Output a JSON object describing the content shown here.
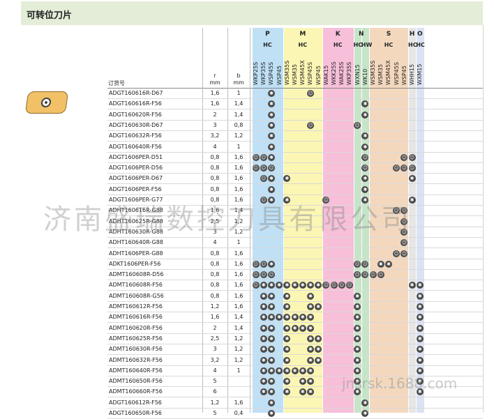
{
  "title": "可转位刀片",
  "headers": {
    "order_no": "订货号",
    "r": "r",
    "r_unit": "mm",
    "b": "b",
    "b_unit": "mm"
  },
  "groups": [
    {
      "letter": "P",
      "sub": "HC",
      "color": "#bfe0f5",
      "grades": [
        "WKP25S",
        "WKP35S",
        "WSP45S",
        "WSP45"
      ]
    },
    {
      "letter": "M",
      "sub": "HC",
      "color": "#fbf6b4",
      "grades": [
        "WSM35S",
        "WSM35",
        "WSM45X",
        "WSP45S",
        "WSP45"
      ]
    },
    {
      "letter": "K",
      "sub": "HC",
      "color": "#f7bfd9",
      "grades": [
        "WAK15",
        "WKK25S",
        "WAK25S",
        "WKP35S"
      ]
    },
    {
      "letter": "N",
      "sub": "HC",
      "color": "#c6e5c8",
      "grades": [
        "WXN15"
      ]
    },
    {
      "letter": "",
      "sub": "HW",
      "color": "#c6e5c8",
      "grades": [
        "WK10"
      ]
    },
    {
      "letter": "S",
      "sub": "HC",
      "color": "#f4d8be",
      "grades": [
        "WSM35S",
        "WSM35",
        "WSM45X",
        "WSP45S",
        "WSP45"
      ]
    },
    {
      "letter": "H",
      "sub": "HC",
      "color": "#e6e6e6",
      "grades": [
        "WHH15"
      ]
    },
    {
      "letter": "O",
      "sub": "HC",
      "color": "#dbe2f3",
      "grades": [
        "WXM15"
      ]
    }
  ],
  "rows": [
    {
      "code": "ADGT160616R-D67",
      "r": "1,6",
      "b": "1",
      "marks": "..2....1....................1....."
    },
    {
      "code": "ADGT160616R-F56",
      "r": "1,6",
      "b": "1,4",
      "marks": "..3...........2..............2...."
    },
    {
      "code": "ADGT160620R-F56",
      "r": "2",
      "b": "1,4",
      "marks": "..3...........2..............2...."
    },
    {
      "code": "ADGT160630R-D67",
      "r": "3",
      "b": "0,8",
      "marks": "..2....1.....1..............1....."
    },
    {
      "code": "ADGT160632R-F56",
      "r": "3,2",
      "b": "1,2",
      "marks": "..3...........2..............2...."
    },
    {
      "code": "ADGT160640R-F56",
      "r": "4",
      "b": "1",
      "marks": "..3...........2..............2...."
    },
    {
      "code": "ADGT1606PER-D51",
      "r": "0,8",
      "b": "1,6",
      "marks": "112...........1....11........1...."
    },
    {
      "code": "ADGT1606PER-D56",
      "r": "0,8",
      "b": "1,6",
      "marks": "111...........1...111........1...."
    },
    {
      "code": "ADGT1606PER-D67",
      "r": "0,8",
      "b": "1,6",
      "marks": ".12.2.........2.....2.....2..1...."
    },
    {
      "code": "ADGT1606PER-F56",
      "r": "0,8",
      "b": "1,6",
      "marks": "..3...........2..............2...."
    },
    {
      "code": "ADGT1606PER-G77",
      "r": "0,8",
      "b": "1,6",
      "marks": ".12.2....1....2.....2.....2..1...."
    },
    {
      "code": "ADHT160616R-G88",
      "r": "1,6",
      "b": "1,4",
      "marks": "..................11......."
    },
    {
      "code": "ADHT160625R-G88",
      "r": "2,5",
      "b": "1,2",
      "marks": "...................1......."
    },
    {
      "code": "ADHT160630R-G88",
      "r": "3",
      "b": "1,2",
      "marks": "...................1......."
    },
    {
      "code": "ADHT160640R-G88",
      "r": "4",
      "b": "1",
      "marks": "...................1......."
    },
    {
      "code": "ADHT1606PER-G88",
      "r": "0,8",
      "b": "1,6",
      "marks": "..................11......."
    },
    {
      "code": "ADKT1606PER-F56",
      "r": "0,8",
      "b": "1,6",
      "marks": "112..........11.22..........2...."
    },
    {
      "code": "ADMT160608R-D56",
      "r": "0,8",
      "b": "1,6",
      "marks": "111..........1111............1...."
    },
    {
      "code": "ADMT160608R-F56",
      "r": "0,8",
      "b": "1,6",
      "marks": "1222222221111.......22221...."
    },
    {
      "code": "ADMT160608R-G56",
      "r": "0,8",
      "b": "1,6",
      "marks": ".22.2..2.....2.......2222...."
    },
    {
      "code": "ADMT160612R-F56",
      "r": "1,2",
      "b": "1,6",
      "marks": ".22.2..22....2.......2.22...."
    },
    {
      "code": "ADMT160616R-F56",
      "r": "1,6",
      "b": "1,4",
      "marks": ".2222222.....2.......22222..."
    },
    {
      "code": "ADMT160620R-F56",
      "r": "2",
      "b": "1,4",
      "marks": ".22.2222.....2.......2222...."
    },
    {
      "code": "ADMT160625R-F56",
      "r": "2,5",
      "b": "1,2",
      "marks": ".22.2..22....2.......2.22...."
    },
    {
      "code": "ADMT160630R-F56",
      "r": "3",
      "b": "1,2",
      "marks": ".22.2..22....2.......2.22...."
    },
    {
      "code": "ADMT160632R-F56",
      "r": "3,2",
      "b": "1,2",
      "marks": ".22.2..22....2.......2.22...."
    },
    {
      "code": "ADMT160640R-F56",
      "r": "4",
      "b": "1",
      "marks": ".2222222.....2.......22222..."
    },
    {
      "code": "ADMT160650R-F56",
      "r": "5",
      "b": "",
      "marks": ".22.2.22.....2.......2.22...."
    },
    {
      "code": "ADMT160660R-F56",
      "r": "6",
      "b": "",
      "marks": ".22.2.22.....2.......2222...."
    },
    {
      "code": "ADGT160612R-F56",
      "r": "1,2",
      "b": "1,6",
      "marks": "..2...........2.......2......."
    },
    {
      "code": "ADGT160650R-F56",
      "r": "5",
      "b": "0,4",
      "marks": "..2...........2.......2......."
    }
  ],
  "watermark": "济南盛瑞数控刀具有限公司",
  "watermark_url": "jnsrsk.1688.com"
}
